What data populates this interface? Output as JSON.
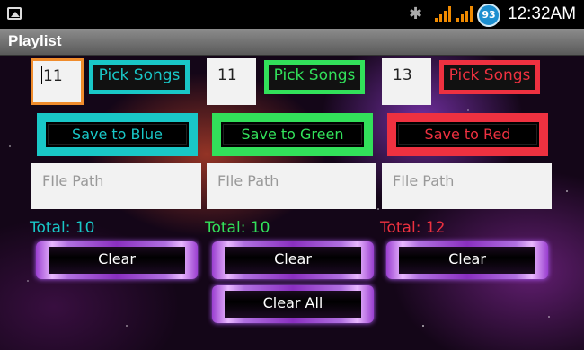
{
  "status_bar": {
    "gallery_icon": "image-icon",
    "bluetooth_icon": "bluetooth-icon",
    "signal_icons": [
      "signal-icon",
      "signal-icon"
    ],
    "battery_level": "93",
    "time": "12:32AM",
    "accent": "#f08a00"
  },
  "title_bar": {
    "title": "Playlist"
  },
  "columns": [
    {
      "color": "#19c7c7",
      "count_value": "11",
      "pick_label": "Pick Songs",
      "save_label": "Save to Blue",
      "path_placeholder": "FIle Path",
      "total_label": "Total: 10",
      "clear_label": "Clear"
    },
    {
      "color": "#32e05a",
      "count_value": "11",
      "pick_label": "Pick Songs",
      "save_label": "Save to Green",
      "path_placeholder": "FIle Path",
      "total_label": "Total: 10",
      "clear_label": "Clear"
    },
    {
      "color": "#ee3140",
      "count_value": "13",
      "pick_label": "Pick Songs",
      "save_label": "Save to Red",
      "path_placeholder": "FIle Path",
      "total_label": "Total: 12",
      "clear_label": "Clear"
    }
  ],
  "clear_all_label": "Clear All",
  "colors": {
    "blue": "#19c7c7",
    "green": "#32e05a",
    "red": "#ee3140",
    "focus": "#f08c2c",
    "clear_glow": "#b35cff"
  }
}
